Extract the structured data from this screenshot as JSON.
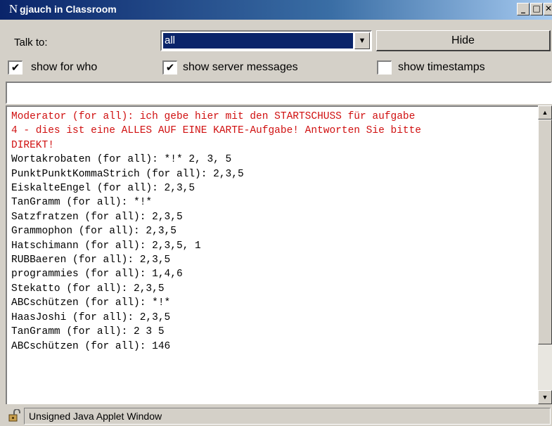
{
  "window": {
    "title": "gjauch in Classroom",
    "icon": "netscape-n-icon",
    "icon_glyph": "N",
    "controls": {
      "minimize": "_",
      "maximize": "□",
      "close": "✕"
    }
  },
  "controls": {
    "talkto_label": "Talk to:",
    "talkto_value": "all",
    "hide_label": "Hide"
  },
  "options": {
    "show_for_who": {
      "label": "show for who",
      "checked": true,
      "mark": "✔"
    },
    "show_server_messages": {
      "label": "show server messages",
      "checked": true,
      "mark": "✔"
    },
    "show_timestamps": {
      "label": "show timestamps",
      "checked": false,
      "mark": ""
    }
  },
  "message_input": {
    "value": ""
  },
  "log": {
    "moderator_lines": [
      "Moderator (for all): ich gebe hier mit den STARTSCHUSS für aufgabe",
      "4 - dies ist eine ALLES AUF EINE KARTE-Aufgabe! Antworten Sie bitte",
      "DIREKT!"
    ],
    "messages": [
      "Wortakrobaten (for all): *!* 2, 3, 5",
      "PunktPunktKommaStrich (for all): 2,3,5",
      "EiskalteEngel (for all): 2,3,5",
      "TanGramm (for all): *!*",
      "Satzfratzen (for all): 2,3,5",
      "Grammophon (for all): 2,3,5",
      "Hatschimann (for all): 2,3,5, 1",
      "RUBBaeren (for all): 2,3,5",
      "programmies (for all): 1,4,6",
      "Stekatto (for all): 2,3,5",
      "ABCschützen (for all): *!*",
      "HaasJoshi (for all): 2,3,5",
      "TanGramm (for all): 2 3 5",
      "ABCschützen (for all): 146"
    ]
  },
  "scrollbar": {
    "up_arrow": "▲",
    "down_arrow": "▼"
  },
  "status": {
    "icon": "unlocked-padlock-icon",
    "text": "Unsigned Java Applet Window"
  },
  "colors": {
    "title_start": "#0a246a",
    "moderator_text": "#d01010",
    "selection": "#0a246a"
  }
}
